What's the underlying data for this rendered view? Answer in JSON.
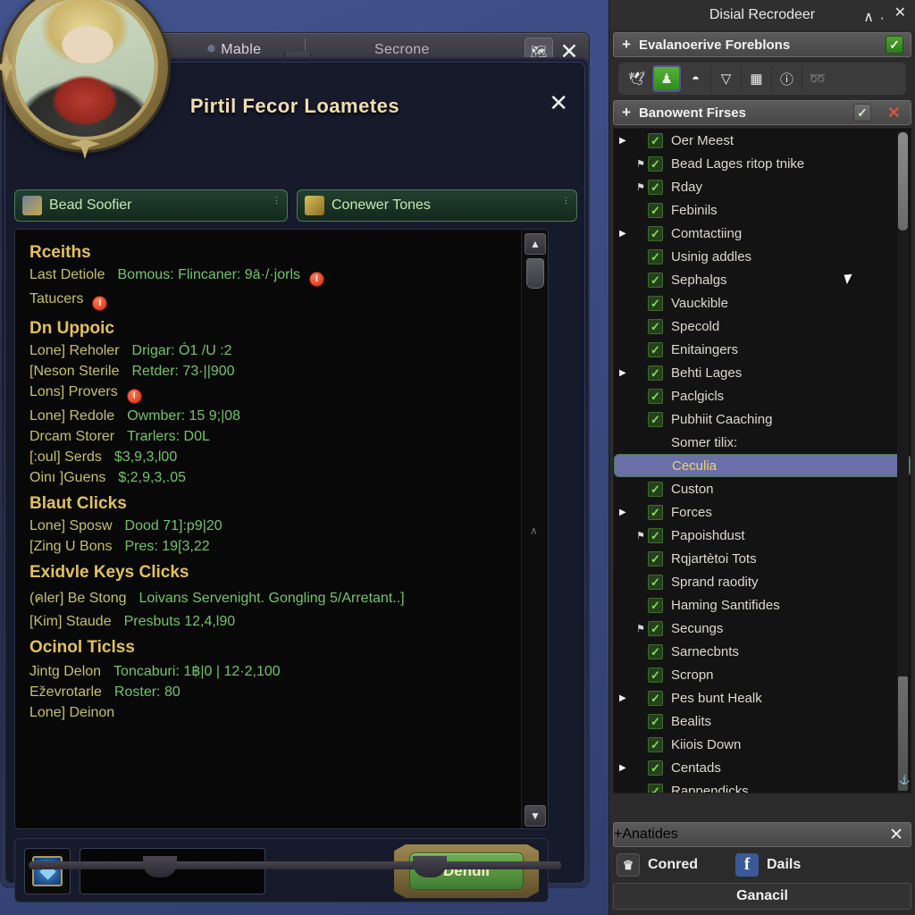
{
  "game": {
    "tabs": [
      {
        "label": "Mable",
        "icon": "leaf-icon"
      },
      {
        "label": "Secrone",
        "icon": ""
      }
    ],
    "toolbar": {
      "map_icon": "map-icon",
      "close_label": "✕"
    },
    "panel_title": "Pirtil Fecor Loametes",
    "panel_close_label": "✕",
    "portrait_name": "character-portrait",
    "selects": [
      {
        "label": "Bead Soofier",
        "icon": "scroll-icon"
      },
      {
        "label": "Conewer Tones",
        "icon": "gold-scroll-icon"
      }
    ],
    "sections": [
      {
        "heading": "Rceiths",
        "rows": [
          {
            "key": "Last Detiole",
            "value": "Bomous: Flincaner: 9ā·/·jorls",
            "warn": true
          },
          {
            "key": "Tatucers",
            "value": "",
            "warn": true
          }
        ]
      },
      {
        "heading": "Dn Uppoic",
        "rows": [
          {
            "key": "Lone] Reholer",
            "value": "Drigar: Ó1 /U :2",
            "warn": false
          },
          {
            "key": "[Neson Sterile",
            "value": "Retder: 73·||900",
            "warn": false
          },
          {
            "key": "Lons] Provers",
            "value": "",
            "warn": true
          },
          {
            "key": "Lone] Redole",
            "value": "Owmber: 15 9;|08",
            "warn": false
          },
          {
            "key": "Drcam Storer",
            "value": "Trarlers: D0L",
            "warn": false
          },
          {
            "key": "[:oul] Serds",
            "value": "$3,9,3,l00",
            "warn": false
          },
          {
            "key": "Oinı ]Guens",
            "value": "$;2,9,3,.05",
            "warn": false
          }
        ]
      },
      {
        "heading": "Blaut Clicks",
        "rows": [
          {
            "key": "Lone] Sposw",
            "value": "Dood 71]:p9|20",
            "warn": false
          },
          {
            "key": "[Zing U Bons",
            "value": "Pres: 19[3,22",
            "warn": false
          }
        ]
      },
      {
        "heading": "Exidvle Keys Clicks",
        "rows": [
          {
            "key": "(คler] Be Stong",
            "value": "Loivans Servenight.   Gongling 5/Arretant..]",
            "warn": false
          },
          {
            "key": "[Kim] Staude",
            "value": "Presbuts 12,4,l90",
            "warn": false
          }
        ]
      },
      {
        "heading": "Ocinol Ticlss",
        "rows": [
          {
            "key": "Jintg Delon",
            "value": "Toncaburi: 1฿|0 | 12·2,100",
            "warn": false
          },
          {
            "key": "Eževrotarle",
            "value": "Roster: 80",
            "warn": false
          },
          {
            "key": "Lone] Deinon",
            "value": "",
            "warn": false
          }
        ]
      }
    ],
    "scroll": {
      "up": "▲",
      "down": "▼",
      "mid": "∧"
    },
    "bottom": {
      "slot_icon": "gem-icon",
      "input_value": "",
      "action_label": "Dendil"
    }
  },
  "addon": {
    "title": "Disial Recrodeer",
    "minimize_label": "∧",
    "dot_label": "·",
    "close_label": "✕",
    "header_bar": {
      "plus": "+",
      "label": "Evalanoerive Foreblons",
      "check": "✓"
    },
    "toolbar_icons": [
      {
        "name": "bird-icon",
        "glyph": "🕊",
        "active": false
      },
      {
        "name": "chess-piece-icon",
        "glyph": "♟",
        "active": true
      },
      {
        "name": "pot-icon",
        "glyph": "◓",
        "active": false
      },
      {
        "name": "funnel-icon",
        "glyph": "▽",
        "active": false
      },
      {
        "name": "picture-icon",
        "glyph": "▦",
        "active": false
      },
      {
        "name": "info-icon",
        "glyph": "ⓘ",
        "active": false
      },
      {
        "name": "wing-icon",
        "glyph": "➿",
        "active": false
      }
    ],
    "section_bar": {
      "plus": "+",
      "label": "Banowent Firses",
      "check": "✓",
      "close": "✕"
    },
    "list": [
      {
        "label": "Oer Meest",
        "checked": true,
        "arrow": true,
        "pin": false
      },
      {
        "label": "Bead Lages ritop tnike",
        "checked": true,
        "arrow": false,
        "pin": true
      },
      {
        "label": "Rday",
        "checked": true,
        "arrow": false,
        "pin": true
      },
      {
        "label": "Febinils",
        "checked": true,
        "arrow": false,
        "pin": false
      },
      {
        "label": "Comtactiing",
        "checked": true,
        "arrow": true,
        "pin": false
      },
      {
        "label": "Usinig addles",
        "checked": true,
        "arrow": false,
        "pin": false
      },
      {
        "label": "Sephalgs",
        "checked": true,
        "arrow": false,
        "pin": false
      },
      {
        "label": "Vauckible",
        "checked": true,
        "arrow": false,
        "pin": false
      },
      {
        "label": "Specold",
        "checked": true,
        "arrow": false,
        "pin": false
      },
      {
        "label": "Enitaingers",
        "checked": true,
        "arrow": false,
        "pin": false
      },
      {
        "label": "Behti Lages",
        "checked": true,
        "arrow": true,
        "pin": false
      },
      {
        "label": "Paclgicls",
        "checked": true,
        "arrow": false,
        "pin": false
      },
      {
        "label": "Pubhiit Caaching",
        "checked": true,
        "arrow": false,
        "pin": false
      },
      {
        "label": "Somer tilix:",
        "checked": false,
        "arrow": false,
        "pin": false
      },
      {
        "label": "Ceculia",
        "checked": false,
        "arrow": false,
        "pin": false,
        "selected": true
      },
      {
        "label": "Custon",
        "checked": true,
        "arrow": false,
        "pin": false
      },
      {
        "label": "Forces",
        "checked": true,
        "arrow": true,
        "pin": false
      },
      {
        "label": "Papoishdust",
        "checked": true,
        "arrow": false,
        "pin": true
      },
      {
        "label": "Rqjartètoi Tots",
        "checked": true,
        "arrow": false,
        "pin": false
      },
      {
        "label": "Sprand raodity",
        "checked": true,
        "arrow": false,
        "pin": false
      },
      {
        "label": "Haming Santifides",
        "checked": true,
        "arrow": false,
        "pin": false
      },
      {
        "label": "Secungs",
        "checked": true,
        "arrow": false,
        "pin": true
      },
      {
        "label": "Sarnecbnts",
        "checked": true,
        "arrow": false,
        "pin": false
      },
      {
        "label": "Scropn",
        "checked": true,
        "arrow": false,
        "pin": false
      },
      {
        "label": "Pes bunt Healk",
        "checked": true,
        "arrow": true,
        "pin": false
      },
      {
        "label": "Bealits",
        "checked": true,
        "arrow": false,
        "pin": false
      },
      {
        "label": "Kiiois Down",
        "checked": true,
        "arrow": false,
        "pin": false
      },
      {
        "label": "Centads",
        "checked": true,
        "arrow": true,
        "pin": false
      },
      {
        "label": "Rappendicks",
        "checked": true,
        "arrow": false,
        "pin": false
      }
    ],
    "footer": {
      "bar": {
        "plus": "+",
        "label": "Anatides",
        "close": "✕"
      },
      "social": [
        {
          "name": "twitch-icon",
          "glyph": "♛",
          "label": "Conred",
          "kind": "tw"
        },
        {
          "name": "facebook-icon",
          "glyph": "f",
          "label": "Dails",
          "kind": "fb"
        }
      ],
      "wide_label": "Ganacil"
    }
  },
  "colors": {
    "accent_green": "#72c46a",
    "accent_gold": "#e2c15c",
    "warn_red": "#d12d18",
    "selection_blue": "#6b6fa8"
  }
}
